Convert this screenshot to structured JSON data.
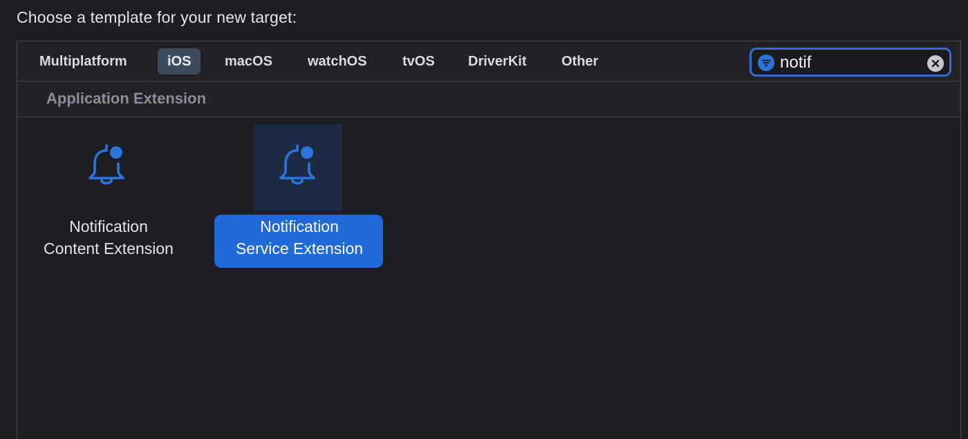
{
  "heading": "Choose a template for your new target:",
  "tabs": [
    {
      "label": "Multiplatform",
      "selected": false
    },
    {
      "label": "iOS",
      "selected": true
    },
    {
      "label": "macOS",
      "selected": false
    },
    {
      "label": "watchOS",
      "selected": false
    },
    {
      "label": "tvOS",
      "selected": false
    },
    {
      "label": "DriverKit",
      "selected": false
    },
    {
      "label": "Other",
      "selected": false
    }
  ],
  "search": {
    "value": "notif",
    "filter_icon": "filter-icon",
    "clear_icon": "clear-icon"
  },
  "section": {
    "title": "Application Extension"
  },
  "templates": [
    {
      "line1": "Notification",
      "line2": "Content Extension",
      "icon": "bell-badge-icon",
      "selected": false
    },
    {
      "line1": "Notification",
      "line2": "Service Extension",
      "icon": "bell-badge-icon",
      "selected": true
    }
  ],
  "colors": {
    "accent": "#1f6ad8",
    "background": "#1f1d24",
    "tab_selected": "#3e4b5e"
  }
}
